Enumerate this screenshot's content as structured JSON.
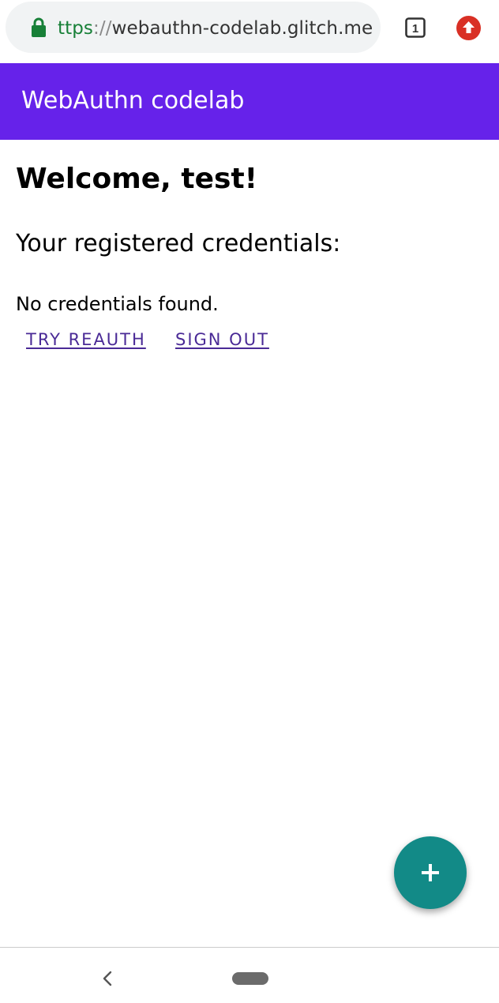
{
  "browser": {
    "url_scheme": "ttps",
    "url_separator": "://",
    "url_host": "webauthn-codelab.glitch.me",
    "tab_count": "1",
    "icons": {
      "lock": "lock-icon",
      "tabs": "tab-switcher-icon",
      "update": "update-icon"
    }
  },
  "header": {
    "title": "WebAuthn codelab",
    "color": "#6622ea"
  },
  "main": {
    "welcome": "Welcome, test!",
    "credentials_heading": "Your registered credentials:",
    "empty_message": "No credentials found.",
    "buttons": {
      "reauth": "TRY REAUTH",
      "signout": "SIGN OUT"
    },
    "link_color": "#4a2a96"
  },
  "fab": {
    "icon": "plus-icon",
    "color": "#128a87"
  },
  "nav": {
    "back_icon": "chevron-left-icon",
    "home_icon": "home-pill-icon"
  }
}
